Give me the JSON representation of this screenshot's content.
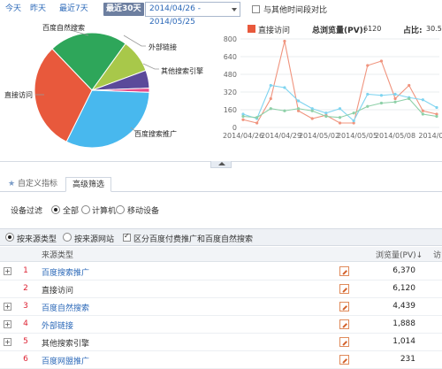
{
  "toolbar": {
    "ranges": [
      "今天",
      "昨天",
      "最近7天",
      "最近30天"
    ],
    "active_range": "最近30天",
    "date_range": "2014/04/26 - 2014/05/25",
    "compare_label": "与其他时间段对比"
  },
  "pie": {
    "segments": [
      {
        "label": "直接访问",
        "value": 6120,
        "color": "#e8593c"
      },
      {
        "label": "百度自然搜索",
        "value": 4439,
        "color": "#2ea65a"
      },
      {
        "label": "外部链接",
        "value": 1888,
        "color": "#a8c84a"
      },
      {
        "label": "其他搜索引擎",
        "value": 1014,
        "color": "#5b4a9a"
      },
      {
        "label": "百度网盟推广",
        "value": 231,
        "color": "#e84b8a"
      },
      {
        "label": "百度搜索推广",
        "value": 6370,
        "color": "#48b8ee"
      }
    ]
  },
  "line_chart": {
    "legend_label": "直接访问",
    "total_label": "总浏览量(PV):",
    "total_value": "6120",
    "share_label": "占比:",
    "share_value": "30.5",
    "y_ticks": [
      "800",
      "640",
      "480",
      "320",
      "160",
      "0"
    ],
    "x_ticks": [
      "2014/04/26",
      "2014/04/29",
      "2014/05/02",
      "2014/05/05",
      "2014/05/08",
      "2014/05"
    ]
  },
  "chart_data": {
    "type": "line",
    "x": [
      "04/26",
      "04/27",
      "04/28",
      "04/29",
      "04/30",
      "05/01",
      "05/02",
      "05/03",
      "05/04",
      "05/05",
      "05/06",
      "05/07",
      "05/08",
      "05/09",
      "05/10"
    ],
    "ylim": [
      0,
      800
    ],
    "series": [
      {
        "name": "直接访问",
        "color": "#f0947e",
        "values": [
          70,
          40,
          260,
          780,
          150,
          80,
          110,
          40,
          40,
          560,
          600,
          260,
          380,
          150,
          120
        ]
      },
      {
        "color": "#7fd4f0",
        "values": [
          120,
          80,
          380,
          360,
          240,
          170,
          130,
          170,
          60,
          300,
          290,
          300,
          270,
          250,
          180
        ]
      },
      {
        "color": "#8ed0a8",
        "values": [
          100,
          90,
          170,
          150,
          170,
          150,
          100,
          90,
          130,
          190,
          220,
          230,
          260,
          120,
          100
        ]
      }
    ]
  },
  "tabs": {
    "custom": "自定义指标",
    "advanced": "高级筛选"
  },
  "device_filter": {
    "label": "设备过滤",
    "options": [
      "全部",
      "计算机",
      "移动设备"
    ],
    "selected": "全部"
  },
  "filter_bar": {
    "by_source_type": "按来源类型",
    "by_source_site": "按来源网站",
    "distinguish": "区分百度付费推广和百度自然搜索"
  },
  "table": {
    "col_source": "来源类型",
    "col_pv": "浏览量(PV)",
    "col_more": "访",
    "rows": [
      {
        "num": "1",
        "name": "百度搜索推广",
        "pv": "6,370",
        "link": true,
        "expand": true
      },
      {
        "num": "2",
        "name": "直接访问",
        "pv": "6,120",
        "link": false,
        "expand": false
      },
      {
        "num": "3",
        "name": "百度自然搜索",
        "pv": "4,439",
        "link": true,
        "expand": true
      },
      {
        "num": "4",
        "name": "外部链接",
        "pv": "1,888",
        "link": true,
        "expand": true
      },
      {
        "num": "5",
        "name": "其他搜索引擎",
        "pv": "1,014",
        "link": false,
        "expand": true
      },
      {
        "num": "6",
        "name": "百度网盟推广",
        "pv": "231",
        "link": true,
        "expand": false
      }
    ]
  }
}
